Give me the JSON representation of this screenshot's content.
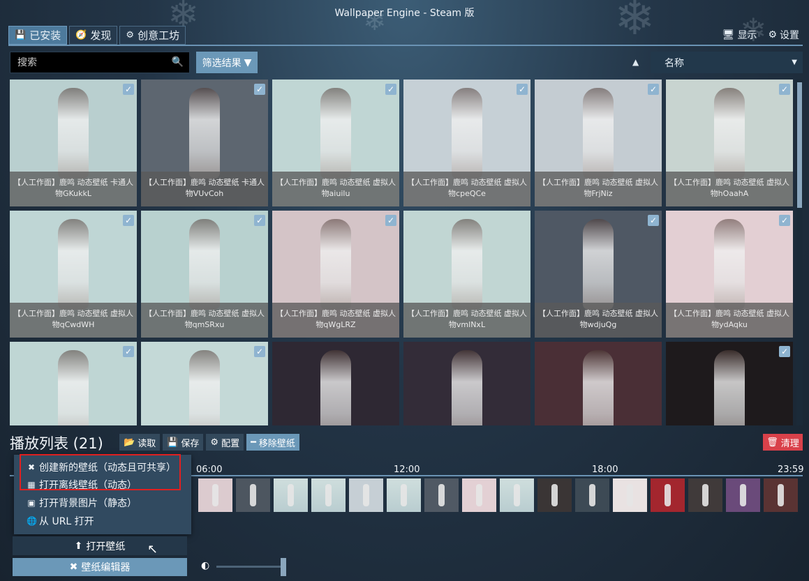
{
  "window": {
    "title": "Wallpaper Engine - Steam 版"
  },
  "tabs": [
    {
      "label": "已安装",
      "icon": "save-icon",
      "active": true
    },
    {
      "label": "发现",
      "icon": "compass-icon",
      "active": false
    },
    {
      "label": "创意工坊",
      "icon": "steam-icon",
      "active": false
    }
  ],
  "top_right": {
    "display_label": "显示",
    "settings_label": "设置"
  },
  "search": {
    "placeholder": "搜索",
    "value": ""
  },
  "filter": {
    "label": "筛选结果"
  },
  "sort": {
    "selected": "名称"
  },
  "tiles": [
    {
      "caption_line1": "【人工作面】鹿鸣 动态壁纸 卡通人",
      "caption_line2": "物GKukkL",
      "checked": true,
      "bg": "#b9cfcf"
    },
    {
      "caption_line1": "【人工作面】鹿鸣 动态壁纸 卡通人",
      "caption_line2": "物VUvCoh",
      "checked": true,
      "bg": "#5d6670"
    },
    {
      "caption_line1": "【人工作面】鹿鸣 动态壁纸 虚拟人",
      "caption_line2": "物aiuilu",
      "checked": true,
      "bg": "#c0d6d4"
    },
    {
      "caption_line1": "【人工作面】鹿鸣 动态壁纸 虚拟人",
      "caption_line2": "物cpeQCe",
      "checked": true,
      "bg": "#c6d0d6"
    },
    {
      "caption_line1": "【人工作面】鹿鸣 动态壁纸 虚拟人",
      "caption_line2": "物FrjNiz",
      "checked": true,
      "bg": "#c4ccd2"
    },
    {
      "caption_line1": "【人工作面】鹿鸣 动态壁纸 虚拟人",
      "caption_line2": "物hOaahA",
      "checked": true,
      "bg": "#c8d4d0"
    },
    {
      "caption_line1": "【人工作面】鹿鸣 动态壁纸 虚拟人",
      "caption_line2": "物qCwdWH",
      "checked": true,
      "bg": "#bfd6d5"
    },
    {
      "caption_line1": "【人工作面】鹿鸣 动态壁纸 虚拟人",
      "caption_line2": "物qmSRxu",
      "checked": true,
      "bg": "#b8d1cf"
    },
    {
      "caption_line1": "【人工作面】鹿鸣 动态壁纸 虚拟人",
      "caption_line2": "物qWgLRZ",
      "checked": true,
      "bg": "#d4c4c7"
    },
    {
      "caption_line1": "【人工作面】鹿鸣 动态壁纸 虚拟人",
      "caption_line2": "物vmlNxL",
      "checked": false,
      "bg": "#c1d6d3"
    },
    {
      "caption_line1": "【人工作面】鹿鸣 动态壁纸 虚拟人",
      "caption_line2": "物wdjuQg",
      "checked": true,
      "bg": "#4f5864"
    },
    {
      "caption_line1": "【人工作面】鹿鸣 动态壁纸 虚拟人",
      "caption_line2": "物ydAqku",
      "checked": true,
      "bg": "#e3cfd3"
    },
    {
      "caption_line1": "",
      "caption_line2": "",
      "checked": true,
      "bg": "#bfd6d4"
    },
    {
      "caption_line1": "",
      "caption_line2": "",
      "checked": true,
      "bg": "#c4d9d7"
    },
    {
      "caption_line1": "",
      "caption_line2": "",
      "checked": false,
      "bg": "#2e2833"
    },
    {
      "caption_line1": "",
      "caption_line2": "",
      "checked": false,
      "bg": "#332c38"
    },
    {
      "caption_line1": "",
      "caption_line2": "",
      "checked": false,
      "bg": "#4a2f36"
    },
    {
      "caption_line1": "",
      "caption_line2": "",
      "checked": true,
      "bg": "#1e1a1c"
    }
  ],
  "playlist": {
    "title": "播放列表 (21)",
    "load_label": "读取",
    "save_label": "保存",
    "config_label": "配置",
    "remove_label": "移除壁纸",
    "clear_label": "清理"
  },
  "timeline": {
    "labels": [
      "06:00",
      "12:00",
      "18:00",
      "23:59"
    ]
  },
  "context_menu": {
    "items": [
      {
        "label": "创建新的壁纸（动态且可共享）",
        "icon": "tools-icon"
      },
      {
        "label": "打开离线壁纸（动态）",
        "icon": "film-icon"
      },
      {
        "label": "打开背景图片（静态）",
        "icon": "image-icon"
      },
      {
        "label": "从 URL 打开",
        "icon": "globe-icon"
      }
    ]
  },
  "bottom": {
    "open_label": "打开壁纸",
    "editor_label": "壁纸编辑器"
  },
  "colors": {
    "accent": "#6b98b8",
    "danger": "#d9414a",
    "highlight": "#e02020"
  }
}
